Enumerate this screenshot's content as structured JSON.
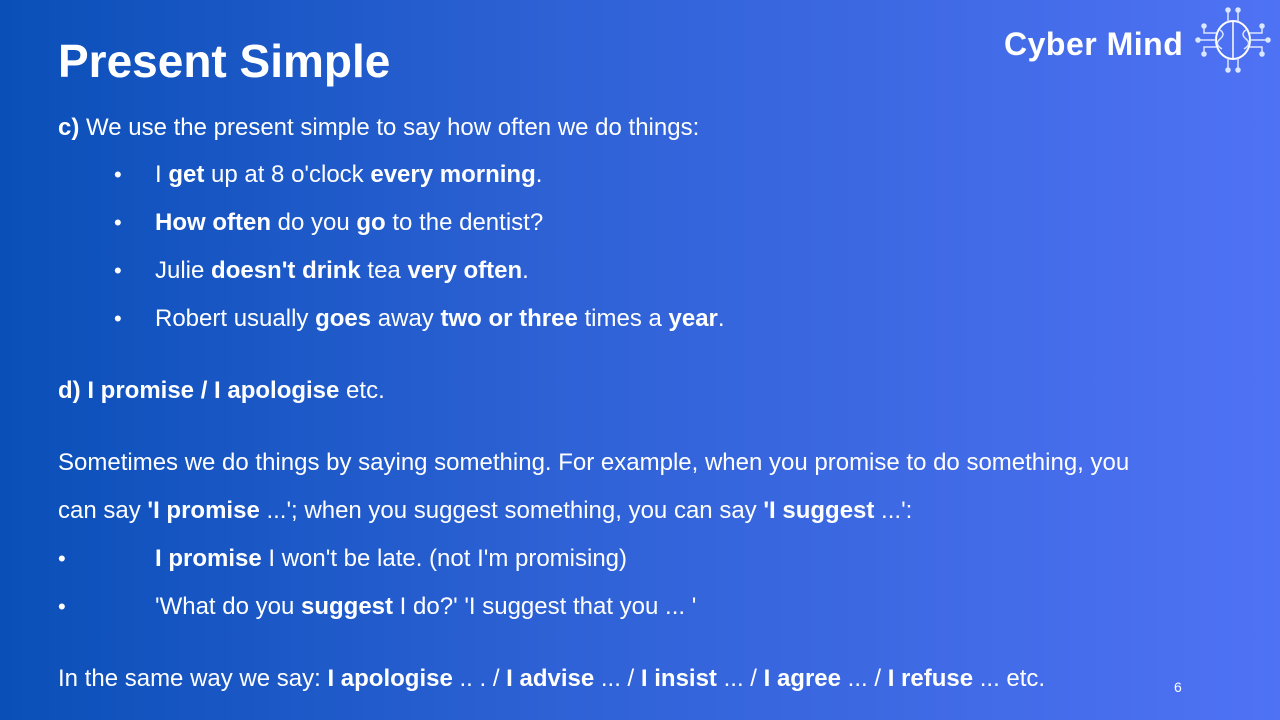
{
  "slide": {
    "title": "Present Simple",
    "logo_text": "Cyber Mind",
    "page_number": "6",
    "bullet_glyph": "•",
    "section_c": {
      "label": "c)",
      "intro": " We use the present simple to say how often we do things:",
      "bullets": [
        [
          {
            "t": "I ",
            "b": false
          },
          {
            "t": "get",
            "b": true
          },
          {
            "t": " up at 8 o'clock ",
            "b": false
          },
          {
            "t": "every morning",
            "b": true
          },
          {
            "t": ".",
            "b": false
          }
        ],
        [
          {
            "t": "How often",
            "b": true
          },
          {
            "t": " do you ",
            "b": false
          },
          {
            "t": "go",
            "b": true
          },
          {
            "t": " to the dentist?",
            "b": false
          }
        ],
        [
          {
            "t": "Julie ",
            "b": false
          },
          {
            "t": "doesn't drink",
            "b": true
          },
          {
            "t": " tea ",
            "b": false
          },
          {
            "t": "very often",
            "b": true
          },
          {
            "t": ".",
            "b": false
          }
        ],
        [
          {
            "t": "Robert usually ",
            "b": false
          },
          {
            "t": "goes",
            "b": true
          },
          {
            "t": " away ",
            "b": false
          },
          {
            "t": "two or three",
            "b": true
          },
          {
            "t": " times a ",
            "b": false
          },
          {
            "t": "year",
            "b": true
          },
          {
            "t": ".",
            "b": false
          }
        ]
      ]
    },
    "section_d": {
      "heading": [
        {
          "t": "d) I promise / I apologise",
          "b": true
        },
        {
          "t": " etc.",
          "b": false
        }
      ],
      "paragraph": [
        [
          {
            "t": "Sometimes we do things by saying something. For example, when you promise to do something, you",
            "b": false
          }
        ],
        [
          {
            "t": "can say ",
            "b": false
          },
          {
            "t": "'I promise",
            "b": true
          },
          {
            "t": " ...'; when you suggest something, you can say ",
            "b": false
          },
          {
            "t": "'I suggest",
            "b": true
          },
          {
            "t": " ...':",
            "b": false
          }
        ]
      ],
      "examples": [
        [
          {
            "t": "I promise",
            "b": true
          },
          {
            "t": " I won't be late. (not I'm promising)",
            "b": false
          }
        ],
        [
          {
            "t": "'What do you ",
            "b": false
          },
          {
            "t": "suggest",
            "b": true
          },
          {
            "t": " I do?' 'I suggest that you ... '",
            "b": false
          }
        ]
      ],
      "closing": [
        {
          "t": "In the same way we say: ",
          "b": false
        },
        {
          "t": "I apologise",
          "b": true
        },
        {
          "t": " .. . / ",
          "b": false
        },
        {
          "t": "I advise",
          "b": true
        },
        {
          "t": " ... / ",
          "b": false
        },
        {
          "t": "I insist",
          "b": true
        },
        {
          "t": " ... / ",
          "b": false
        },
        {
          "t": "I agree",
          "b": true
        },
        {
          "t": " ... / ",
          "b": false
        },
        {
          "t": "I refuse",
          "b": true
        },
        {
          "t": " ... etc.",
          "b": false
        }
      ]
    },
    "colors": {
      "text": "#ffffff",
      "background_left": "#0a4fb8",
      "background_right": "#4f72f4"
    }
  }
}
